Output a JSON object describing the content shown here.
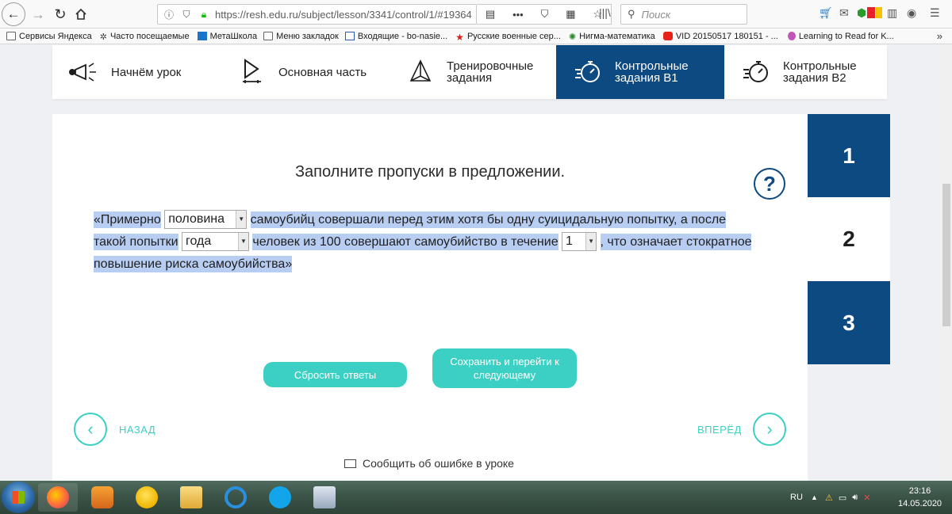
{
  "browser": {
    "url": "https://resh.edu.ru/subject/lesson/3341/control/1/#19364",
    "search_placeholder": "Поиск",
    "bookmarks": [
      {
        "label": "Сервисы Яндекса",
        "icon": "folder-icon"
      },
      {
        "label": "Часто посещаемые",
        "icon": "gear-icon"
      },
      {
        "label": "МетаШкола",
        "icon": "metaschool-icon"
      },
      {
        "label": "Меню закладок",
        "icon": "folder-icon"
      },
      {
        "label": "Входящие - bo-nasie...",
        "icon": "mail-icon"
      },
      {
        "label": "Русские военные сер...",
        "icon": "red-star-icon"
      },
      {
        "label": "Нигма-математика",
        "icon": "nigma-icon"
      },
      {
        "label": "VID 20150517 180151 - ...",
        "icon": "youtube-icon"
      },
      {
        "label": "Learning to Read for K...",
        "icon": "bulb-icon"
      }
    ],
    "more": "»"
  },
  "lesson_nav": {
    "items": [
      {
        "label": "Начнём урок",
        "icon": "megaphone-icon",
        "active": false
      },
      {
        "label": "Основная часть",
        "icon": "play-icon",
        "active": false
      },
      {
        "label": "Тренировочные задания",
        "icon": "pyramid-icon",
        "active": false
      },
      {
        "label": "Контрольные задания В1",
        "icon": "stopwatch-icon",
        "active": true
      },
      {
        "label": "Контрольные задания В2",
        "icon": "stopwatch-icon",
        "active": false
      }
    ]
  },
  "task": {
    "title": "Заполните пропуски в предложении.",
    "help": "?",
    "part1": "«Примерно",
    "select1": "половина",
    "part2": "самоубийц совершали перед этим хотя бы одну суицидальную попытку, а после такой попытки",
    "select2": "года",
    "part3": "человек из 100 совершают самоубийство в течение",
    "select3": "1",
    "part4": ", что означает стократное повышение риска самоубийства»"
  },
  "buttons": {
    "reset": "Сбросить ответы",
    "save": "Сохранить и перейти к следующему",
    "prev": "НАЗАД",
    "next": "ВПЕРЁД",
    "report": "Сообщить об ошибке в уроке"
  },
  "side_tabs": [
    {
      "label": "1",
      "state": "blue"
    },
    {
      "label": "2",
      "state": "current"
    },
    {
      "label": "3",
      "state": "blue"
    }
  ],
  "colors": {
    "primary": "#0e4a82",
    "accent": "#3cd0c4",
    "highlight": "#b8cdf2"
  },
  "taskbar": {
    "apps": [
      "firefox-icon",
      "media-player-icon",
      "smiley-pro-icon",
      "file-explorer-icon",
      "internet-explorer-icon",
      "skype-icon",
      "calculator-icon"
    ],
    "lang": "RU",
    "time": "23:16",
    "date": "14.05.2020"
  }
}
